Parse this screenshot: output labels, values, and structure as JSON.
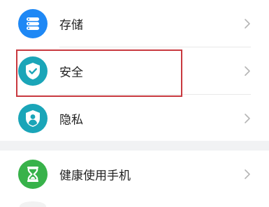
{
  "settings_list": {
    "items": [
      {
        "label": "存储",
        "icon": "storage-icon",
        "icon_color": "#1e88f5"
      },
      {
        "label": "安全",
        "icon": "security-shield-icon",
        "icon_color": "#1aa5b8"
      },
      {
        "label": "隐私",
        "icon": "privacy-icon",
        "icon_color": "#1aa5b8"
      },
      {
        "label": "健康使用手机",
        "icon": "hourglass-icon",
        "icon_color": "#38b24a"
      }
    ],
    "chevron_icon": "chevron-right-icon",
    "highlighted_item": "安全",
    "highlight_color": "#c8383e"
  }
}
